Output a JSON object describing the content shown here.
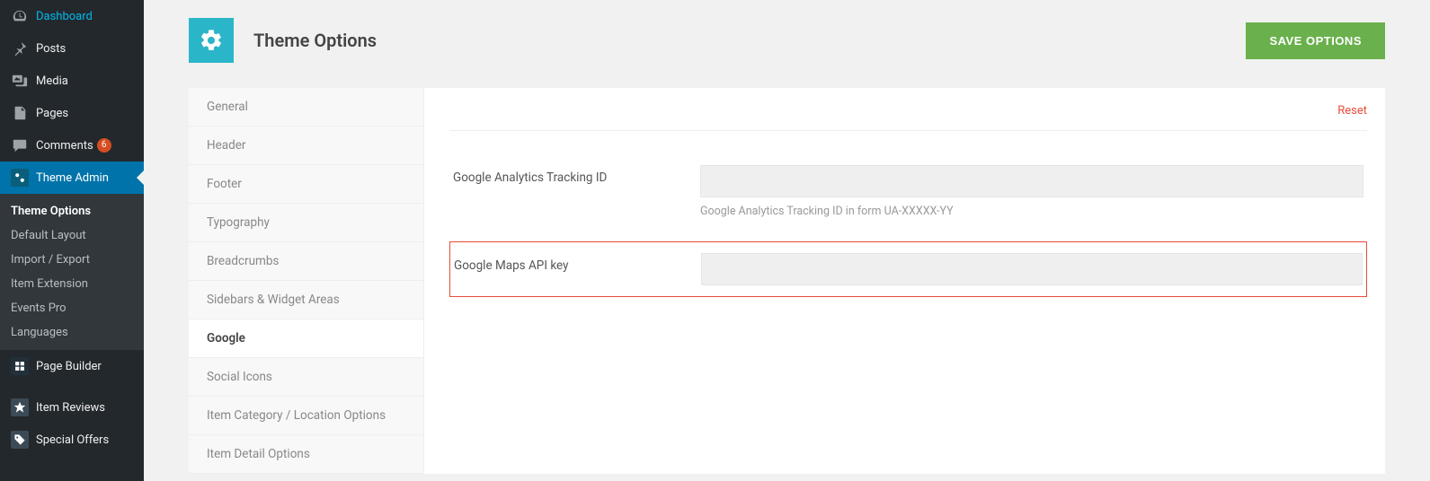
{
  "sidebar": {
    "items": [
      {
        "label": "Dashboard"
      },
      {
        "label": "Posts"
      },
      {
        "label": "Media"
      },
      {
        "label": "Pages"
      },
      {
        "label": "Comments",
        "badge": "6"
      },
      {
        "label": "Theme Admin"
      },
      {
        "label": "Page Builder"
      },
      {
        "label": "Item Reviews"
      },
      {
        "label": "Special Offers"
      }
    ],
    "sub": [
      {
        "label": "Theme Options"
      },
      {
        "label": "Default Layout"
      },
      {
        "label": "Import / Export"
      },
      {
        "label": "Item Extension"
      },
      {
        "label": "Events Pro"
      },
      {
        "label": "Languages"
      }
    ]
  },
  "header": {
    "title": "Theme Options",
    "save_label": "SAVE OPTIONS"
  },
  "tabs": [
    {
      "label": "General"
    },
    {
      "label": "Header"
    },
    {
      "label": "Footer"
    },
    {
      "label": "Typography"
    },
    {
      "label": "Breadcrumbs"
    },
    {
      "label": "Sidebars & Widget Areas"
    },
    {
      "label": "Google"
    },
    {
      "label": "Social Icons"
    },
    {
      "label": "Item Category / Location Options"
    },
    {
      "label": "Item Detail Options"
    }
  ],
  "settings": {
    "reset_label": "Reset",
    "fields": [
      {
        "label": "Google Analytics Tracking ID",
        "value": "",
        "hint": "Google Analytics Tracking ID in form UA-XXXXX-YY"
      },
      {
        "label": "Google Maps API key",
        "value": "",
        "hint": ""
      }
    ]
  }
}
